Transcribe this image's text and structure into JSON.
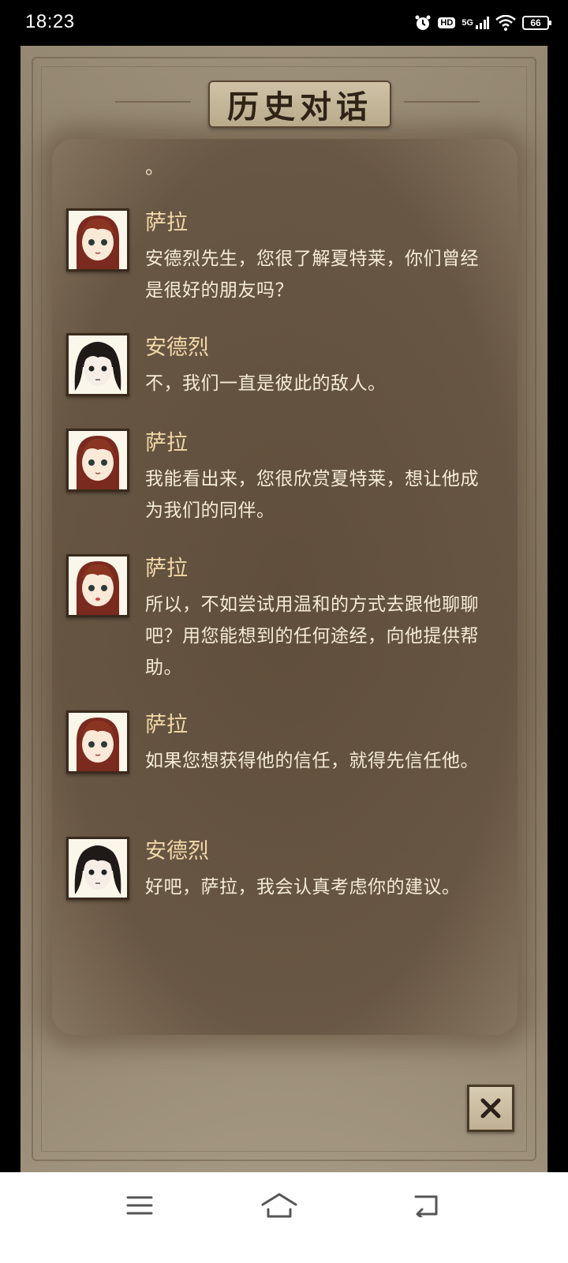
{
  "status_bar": {
    "time": "18:23",
    "icons": [
      "alarm-icon",
      "hd-icon",
      "signal-5g-icon",
      "wifi-icon",
      "battery-icon"
    ],
    "hd_label": "HD",
    "network_label": "5G",
    "battery_level": "66"
  },
  "dialog": {
    "title": "历史对话",
    "truncated_tail": "。",
    "messages": [
      {
        "speaker": "萨拉",
        "avatar": "sara-avatar",
        "text": "安德烈先生，您很了解夏特莱，你们曾经是很好的朋友吗？"
      },
      {
        "speaker": "安德烈",
        "avatar": "andre-avatar",
        "text": "不，我们一直是彼此的敌人。"
      },
      {
        "speaker": "萨拉",
        "avatar": "sara-avatar",
        "text": "我能看出来，您很欣赏夏特莱，想让他成为我们的同伴。"
      },
      {
        "speaker": "萨拉",
        "avatar": "sara-avatar",
        "text": "所以，不如尝试用温和的方式去跟他聊聊吧？用您能想到的任何途经，向他提供帮助。"
      },
      {
        "speaker": "萨拉",
        "avatar": "sara-avatar",
        "text": "如果您想获得他的信任，就得先信任他。"
      },
      {
        "speaker": "安德烈",
        "avatar": "andre-avatar",
        "text": "好吧，萨拉，我会认真考虑你的建议。"
      }
    ],
    "close_icon": "close-icon"
  },
  "nav_bar": {
    "icons": [
      "menu-icon",
      "home-icon",
      "back-icon"
    ]
  },
  "colors": {
    "speaker_name": "#f2d9a8",
    "message_text": "#f4ecd8",
    "parchment": "#9b8d77"
  }
}
